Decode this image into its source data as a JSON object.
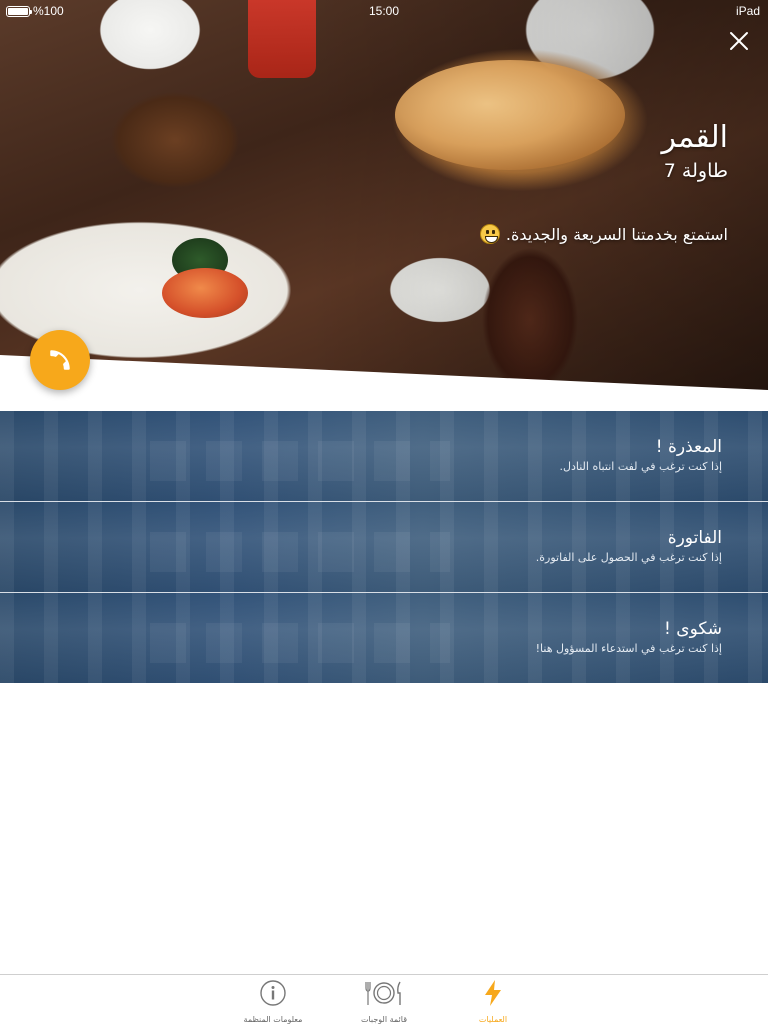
{
  "status_bar": {
    "battery": "%100",
    "time": "15:00",
    "device": "iPad"
  },
  "hero": {
    "venue_name": "القمر",
    "table_label": "طاولة 7",
    "welcome_text": "استمتع بخدمتنا السريعة والجديدة."
  },
  "actions": [
    {
      "title": "المعذرة !",
      "subtitle": "إذا كنت ترغب في لفت انتباه النادل."
    },
    {
      "title": "الفاتورة",
      "subtitle": "إذا كنت ترغب في الحصول على الفاتورة."
    },
    {
      "title": "شكوى !",
      "subtitle": "إذا كنت ترغب في استدعاء المسؤول هنا!"
    }
  ],
  "tabs": {
    "org_info": "معلومات المنظمة",
    "menu": "قائمة الوجبات",
    "operations": "العمليات"
  },
  "colors": {
    "accent": "#f7a81b",
    "action_bg": "#33547a"
  }
}
